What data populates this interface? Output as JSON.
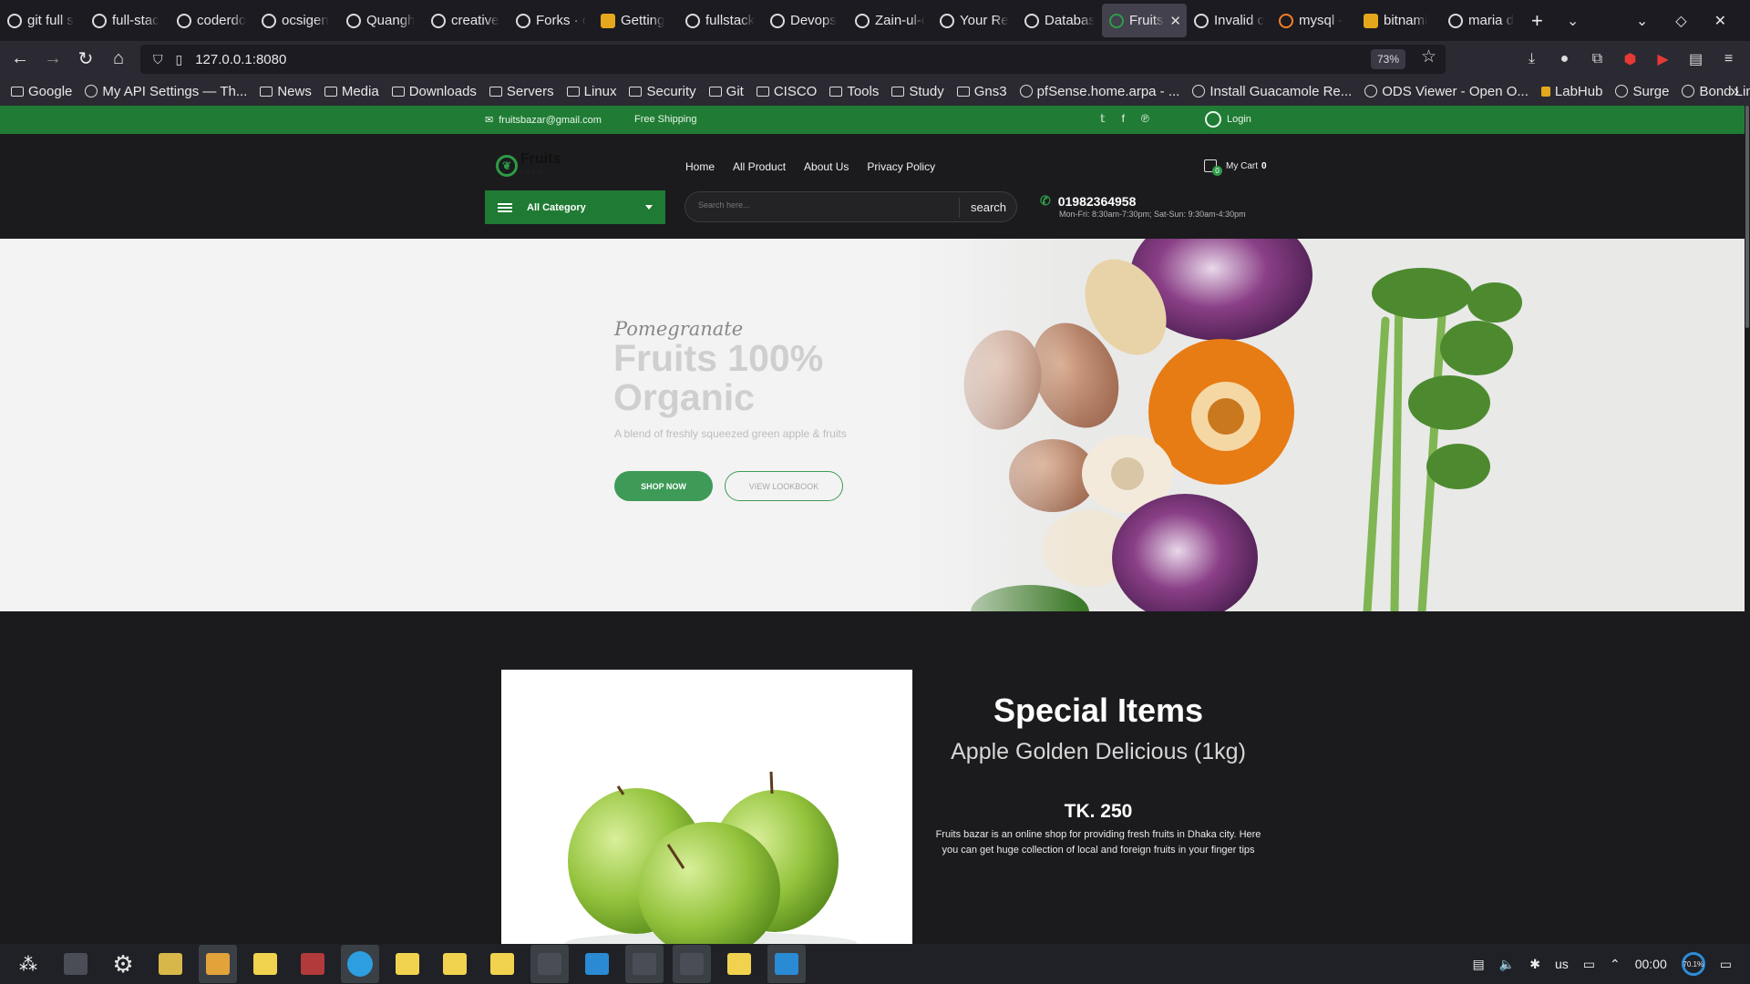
{
  "browser": {
    "tabs": [
      {
        "label": "git full s",
        "icon": "google-icon",
        "active": false
      },
      {
        "label": "full-stac",
        "icon": "github-icon",
        "active": false
      },
      {
        "label": "coderdo",
        "icon": "github-icon",
        "active": false
      },
      {
        "label": "ocsigen",
        "icon": "github-icon",
        "active": false
      },
      {
        "label": "Quangh",
        "icon": "github-icon",
        "active": false
      },
      {
        "label": "creative",
        "icon": "github-icon",
        "active": false
      },
      {
        "label": "Forks · c",
        "icon": "github-icon",
        "active": false
      },
      {
        "label": "Getting",
        "icon": "site-icon",
        "active": false
      },
      {
        "label": "fullstack",
        "icon": "github-icon",
        "active": false
      },
      {
        "label": "Devops",
        "icon": "github-icon",
        "active": false
      },
      {
        "label": "Zain-ul-c",
        "icon": "github-icon",
        "active": false
      },
      {
        "label": "Your Re",
        "icon": "github-icon",
        "active": false
      },
      {
        "label": "Databas",
        "icon": "docker-icon",
        "active": false
      },
      {
        "label": "Fruits",
        "icon": "fruits-icon",
        "active": true
      },
      {
        "label": "Invalid c",
        "icon": "google-icon",
        "active": false
      },
      {
        "label": "mysql -",
        "icon": "stackoverflow-icon",
        "active": false
      },
      {
        "label": "bitnami",
        "icon": "site-icon",
        "active": false
      },
      {
        "label": "maria d",
        "icon": "google-icon",
        "active": false
      }
    ],
    "url": "127.0.0.1:8080",
    "zoom": "73%",
    "bookmarks": [
      {
        "label": "Google",
        "type": "folder"
      },
      {
        "label": "My API Settings — Th...",
        "type": "globe"
      },
      {
        "label": "News",
        "type": "folder"
      },
      {
        "label": "Media",
        "type": "folder"
      },
      {
        "label": "Downloads",
        "type": "folder"
      },
      {
        "label": "Servers",
        "type": "folder"
      },
      {
        "label": "Linux",
        "type": "folder"
      },
      {
        "label": "Security",
        "type": "folder"
      },
      {
        "label": "Git",
        "type": "folder"
      },
      {
        "label": "CISCO",
        "type": "folder"
      },
      {
        "label": "Tools",
        "type": "folder"
      },
      {
        "label": "Study",
        "type": "folder"
      },
      {
        "label": "Gns3",
        "type": "folder"
      },
      {
        "label": "pfSense.home.arpa - ...",
        "type": "globe"
      },
      {
        "label": "Install Guacamole Re...",
        "type": "globe"
      },
      {
        "label": "ODS Viewer - Open O...",
        "type": "globe"
      },
      {
        "label": "LabHub",
        "type": "site"
      },
      {
        "label": "Surge",
        "type": "globe"
      },
      {
        "label": "Bond Linux Netplan",
        "type": "globe"
      }
    ]
  },
  "site": {
    "topstrip": {
      "email": "fruitsbazar@gmail.com",
      "shipping": "Free Shipping",
      "login": "Login"
    },
    "logo_text": "Fruits",
    "logo_sub": "bazar",
    "nav": [
      "Home",
      "All Product",
      "About Us",
      "Privacy Policy"
    ],
    "cart": {
      "label": "My Cart",
      "count": "0",
      "badge": "0"
    },
    "category_button": "All Category",
    "search": {
      "placeholder": "Search here...",
      "button": "search"
    },
    "phone": {
      "number": "01982364958",
      "hours": "Mon-Fri: 8:30am-7:30pm; Sat-Sun: 9:30am-4:30pm"
    },
    "hero": {
      "subtitle": "Pomegranate",
      "title_line1": "Fruits 100%",
      "title_line2": "Organic",
      "blurb": "A blend of freshly squeezed green apple & fruits",
      "shop_now": "SHOP NOW",
      "lookbook": "VIEW LOOKBOOK"
    },
    "special": {
      "title": "Special Items",
      "product": "Apple Golden Delicious (1kg)",
      "price": "TK. 250",
      "description": "Fruits bazar is an online shop for providing fresh fruits in Dhaka city. Here you can get huge collection of local and foreign fruits in your finger tips"
    }
  },
  "taskbar": {
    "keyboard_layout": "us",
    "clock": "00:00",
    "ring_label": "70.1%"
  },
  "colors": {
    "brand_green": "#207c34",
    "button_green": "#3e9a57",
    "page_dark": "#1b1b1d"
  }
}
